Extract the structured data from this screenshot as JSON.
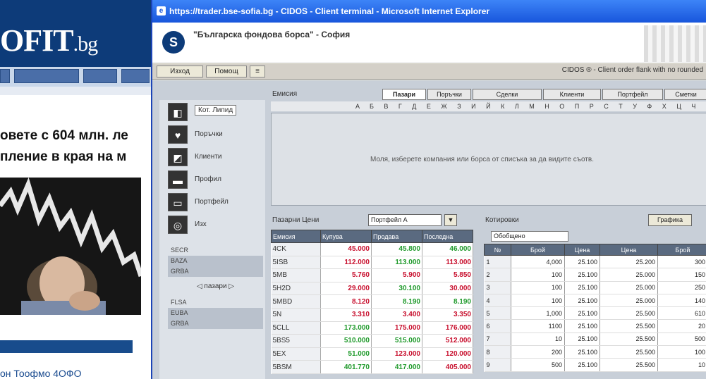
{
  "site": {
    "logo_main": "OFIT",
    "logo_tld": ".bg",
    "nav_items": [
      "",
      "",
      "",
      ""
    ],
    "headline": "овете с 604 млн. ле\nпление в края на м",
    "section_bar": "",
    "link_text": "он Тоофмо 4ОФО"
  },
  "ie": {
    "title": "https://trader.bse-sofia.bg - CIDOS - Client terminal - Microsoft Internet Explorer",
    "icon": "e"
  },
  "app": {
    "logo_glyph": "S",
    "title": "\"Българска фондова борса\" - София",
    "toolbar": {
      "btn1": "Изход",
      "btn2": "Помощ",
      "btn3": "≡",
      "status": "CIDOS ® - Client order flank with no rounded"
    },
    "left_nav": [
      {
        "glyph": "◧",
        "label": "Кот. Липид"
      },
      {
        "glyph": "♥",
        "label": "Поръчки"
      },
      {
        "glyph": "◩",
        "label": "Клиенти"
      },
      {
        "glyph": "▬",
        "label": "Профил"
      },
      {
        "glyph": "▭",
        "label": "Портфейл"
      },
      {
        "glyph": "◎",
        "label": "Изх"
      }
    ],
    "left_codes_a": [
      "SECR",
      "BAZA",
      "GRBA"
    ],
    "left_codes_b": [
      "FLSA",
      "EUBA",
      "GRBA"
    ],
    "market_nav": "пазари",
    "top_panel": {
      "label": "Емисия",
      "tabs": [
        "Пазари",
        "Поръчки",
        "Сделки",
        "Клиенти",
        "Портфейл",
        "Сметки"
      ],
      "alphabet": "A Б В Г Д Е Ж З И Й К Л М Н О П Р С Т У Ф Х Ц Ч Ш Щ Ю Я",
      "message": "Моля, изберете компания или борса от списъка за да видите съотв."
    },
    "quotes": {
      "title": "Пазарни Цени",
      "select_value": "Портфейл А",
      "select_btn": "▼",
      "columns": [
        "Емисия",
        "Купува",
        "Продава",
        "Последна"
      ],
      "rows": [
        {
          "sym": "4CK",
          "c1": "45.000",
          "c2": "45.800",
          "c3": "46.000",
          "k1": "red",
          "k2": "green",
          "k3": "green"
        },
        {
          "sym": "5ISB",
          "c1": "112.000",
          "c2": "113.000",
          "c3": "113.000",
          "k1": "red",
          "k2": "green",
          "k3": "red"
        },
        {
          "sym": "5MB",
          "c1": "5.760",
          "c2": "5.900",
          "c3": "5.850",
          "k1": "red",
          "k2": "red",
          "k3": "red"
        },
        {
          "sym": "5H2D",
          "c1": "29.000",
          "c2": "30.100",
          "c3": "30.000",
          "k1": "red",
          "k2": "green",
          "k3": "red"
        },
        {
          "sym": "5MBD",
          "c1": "8.120",
          "c2": "8.190",
          "c3": "8.190",
          "k1": "red",
          "k2": "green",
          "k3": "green"
        },
        {
          "sym": "5N",
          "c1": "3.310",
          "c2": "3.400",
          "c3": "3.350",
          "k1": "red",
          "k2": "red",
          "k3": "red"
        },
        {
          "sym": "5CLL",
          "c1": "173.000",
          "c2": "175.000",
          "c3": "176.000",
          "k1": "green",
          "k2": "red",
          "k3": "red"
        },
        {
          "sym": "5BS5",
          "c1": "510.000",
          "c2": "515.000",
          "c3": "512.000",
          "k1": "green",
          "k2": "green",
          "k3": "red"
        },
        {
          "sym": "5EX",
          "c1": "51.000",
          "c2": "123.000",
          "c3": "120.000",
          "k1": "green",
          "k2": "red",
          "k3": "red"
        },
        {
          "sym": "5BSM",
          "c1": "401.770",
          "c2": "417.000",
          "c3": "405.000",
          "k1": "green",
          "k2": "green",
          "k3": "red"
        }
      ]
    },
    "book": {
      "title": "Котировки",
      "button": "Графика",
      "sub_select": "Обобщено",
      "columns": [
        "№",
        "Брой",
        "Цена",
        "Цена",
        "Брой"
      ],
      "rows": [
        {
          "i": "1",
          "q1": "4,000",
          "p1": "25.100",
          "p2": "25.200",
          "q2": "300"
        },
        {
          "i": "2",
          "q1": "100",
          "p1": "25.100",
          "p2": "25.000",
          "q2": "150"
        },
        {
          "i": "3",
          "q1": "100",
          "p1": "25.100",
          "p2": "25.000",
          "q2": "250"
        },
        {
          "i": "4",
          "q1": "100",
          "p1": "25.100",
          "p2": "25.000",
          "q2": "140"
        },
        {
          "i": "5",
          "q1": "1,000",
          "p1": "25.100",
          "p2": "25.500",
          "q2": "610"
        },
        {
          "i": "6",
          "q1": "1100",
          "p1": "25.100",
          "p2": "25.500",
          "q2": "20"
        },
        {
          "i": "7",
          "q1": "10",
          "p1": "25.100",
          "p2": "25.500",
          "q2": "500"
        },
        {
          "i": "8",
          "q1": "200",
          "p1": "25.100",
          "p2": "25.500",
          "q2": "100"
        },
        {
          "i": "9",
          "q1": "500",
          "p1": "25.100",
          "p2": "25.500",
          "q2": "10"
        }
      ]
    }
  }
}
